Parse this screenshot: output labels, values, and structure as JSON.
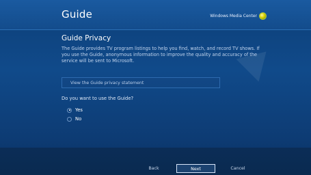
{
  "header": {
    "title": "Guide",
    "brand": "Windows Media Center"
  },
  "main": {
    "section_title": "Guide Privacy",
    "description": "The Guide provides TV program listings to help you find, watch, and record TV shows. If you use the Guide, anonymous information to improve the quality and accuracy of the service will be sent to Microsoft.",
    "privacy_link": "View the Guide privacy statement",
    "question": "Do you want to use the Guide?",
    "options": [
      {
        "label": "Yes",
        "selected": true
      },
      {
        "label": "No",
        "selected": false
      }
    ]
  },
  "footer": {
    "back": "Back",
    "next": "Next",
    "cancel": "Cancel"
  }
}
